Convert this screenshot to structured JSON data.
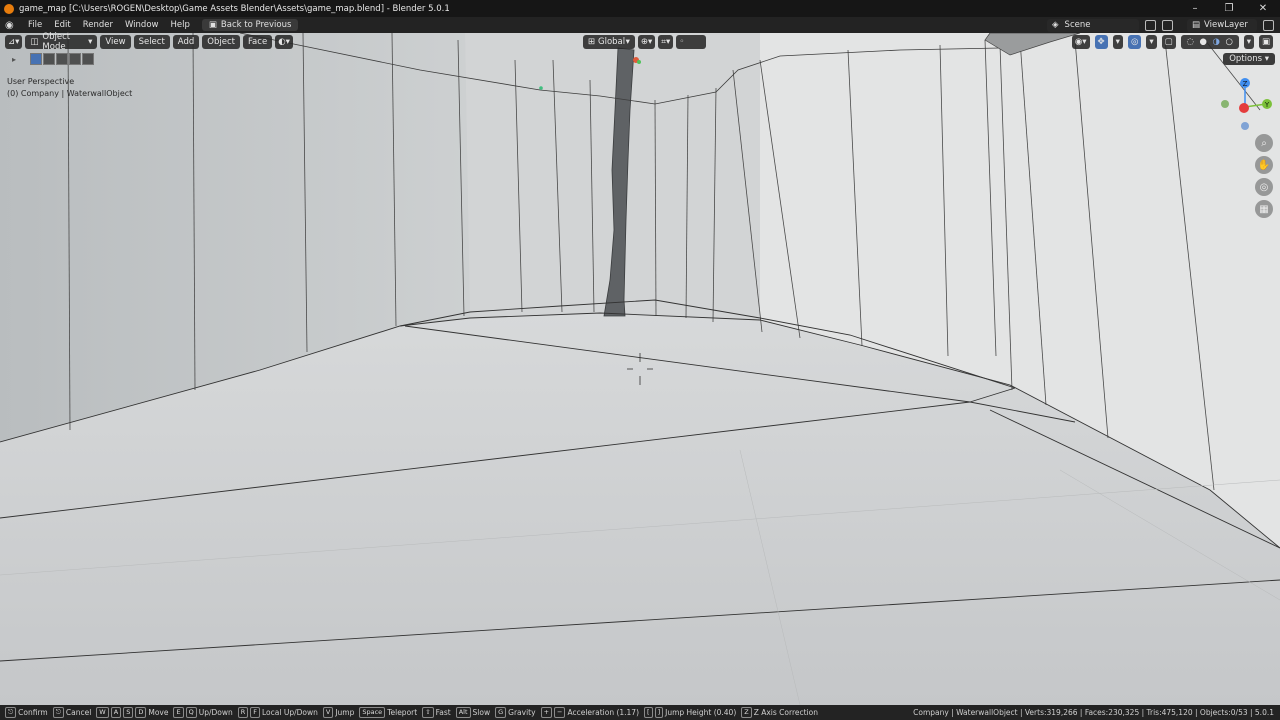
{
  "window": {
    "title": "game_map [C:\\Users\\ROGEN\\Desktop\\Game Assets Blender\\Assets\\game_map.blend] - Blender 5.0.1",
    "controls": [
      "–",
      "❐",
      "✕"
    ]
  },
  "menu": {
    "items": [
      "File",
      "Edit",
      "Render",
      "Window",
      "Help"
    ],
    "back_button": "Back to Previous",
    "scene": "Scene",
    "view_layer": "ViewLayer"
  },
  "viewport_header": {
    "mode": "Object Mode",
    "menus": [
      "View",
      "Select",
      "Add",
      "Object",
      "Face"
    ],
    "transform_orientation": "Global",
    "options_label": "Options"
  },
  "viewport_info": {
    "view": "User Perspective",
    "object": "(0) Company | WaterwallObject"
  },
  "gizmo": {
    "z": "Z",
    "y": "Y",
    "colors": {
      "x": "#e43c3c",
      "y": "#7cc13a",
      "z": "#3f8ef0"
    }
  },
  "status": {
    "hints": [
      {
        "keys": [
          "⎋"
        ],
        "label": "Confirm"
      },
      {
        "keys": [
          "⎋"
        ],
        "label": "Cancel"
      },
      {
        "keys": [
          "W",
          "A",
          "S",
          "D"
        ],
        "label": "Move"
      },
      {
        "keys": [
          "E",
          "Q"
        ],
        "label": "Up/Down"
      },
      {
        "keys": [
          "R",
          "F"
        ],
        "label": "Local Up/Down"
      },
      {
        "keys": [
          "V"
        ],
        "label": "Jump"
      },
      {
        "keys": [
          "Space"
        ],
        "label": "Teleport"
      },
      {
        "keys": [
          "⇧"
        ],
        "label": "Fast"
      },
      {
        "keys": [
          "Alt"
        ],
        "label": "Slow"
      },
      {
        "keys": [
          "G"
        ],
        "label": "Gravity"
      },
      {
        "keys": [
          "+",
          "−"
        ],
        "label": "Acceleration (1.17)"
      },
      {
        "keys": [
          "[",
          "]"
        ],
        "label": "Jump Height (0.40)"
      },
      {
        "keys": [
          "Z"
        ],
        "label": "Z Axis Correction"
      }
    ],
    "stats": "Company | WaterwallObject | Verts:319,266 | Faces:230,325 | Tris:475,120 | Objects:0/53 | 5.0.1"
  }
}
